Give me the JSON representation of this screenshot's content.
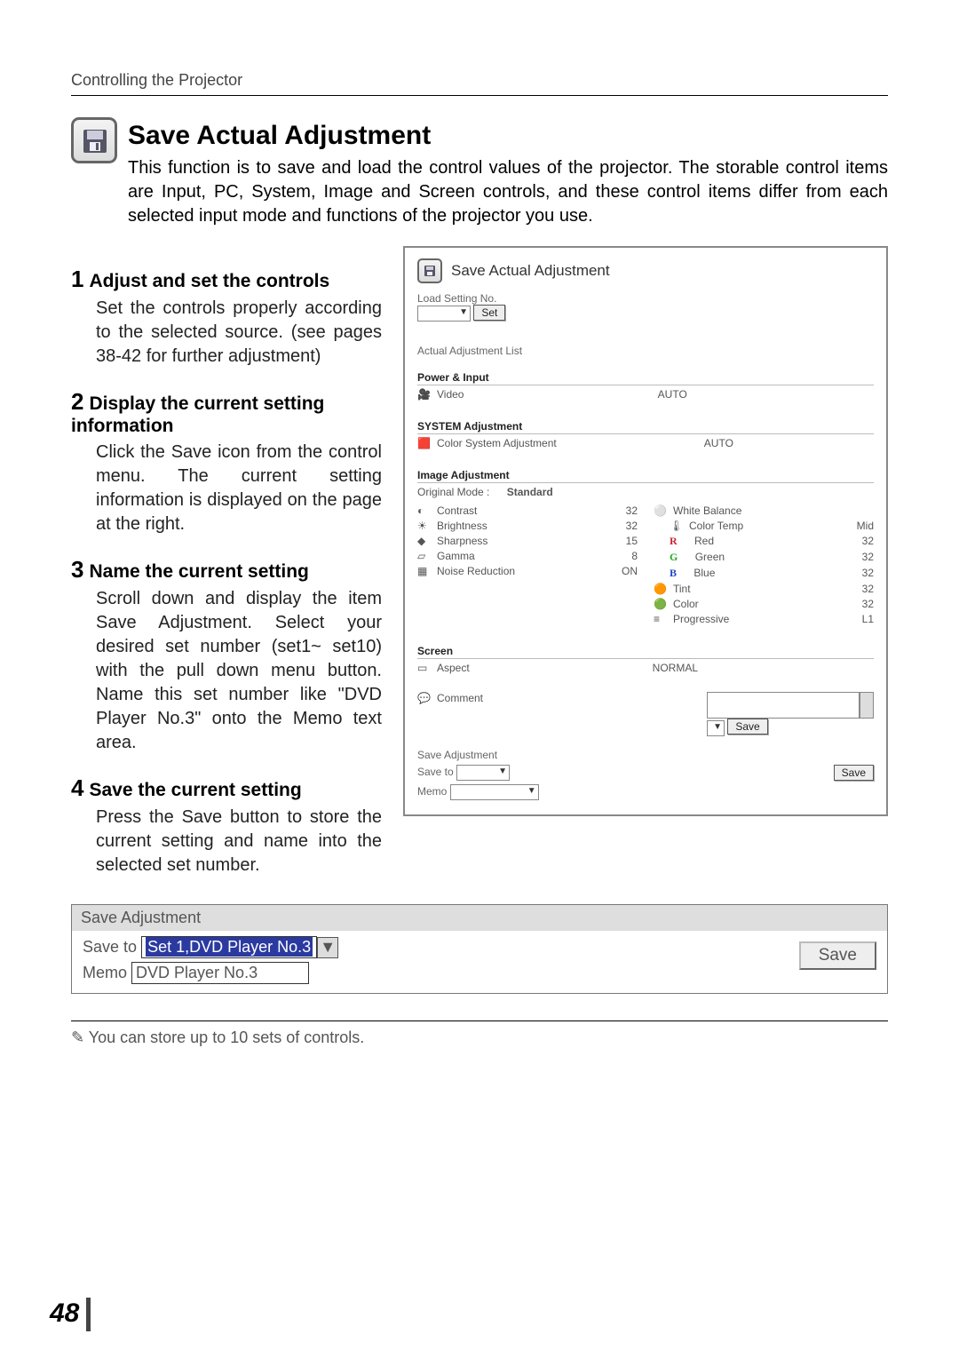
{
  "running_head": "Controlling the Projector",
  "title": "Save Actual Adjustment",
  "intro": "This function is to save and load the control values of the projector. The storable control items are Input, PC, System, Image and Screen controls, and these control items differ from each selected input mode and functions of the projector you use.",
  "steps": [
    {
      "num": "1",
      "head": "Adjust and set the controls",
      "body": "Set the controls properly according to the selected source. (see pages 38-42 for further adjustment)"
    },
    {
      "num": "2",
      "head": "Display the current setting information",
      "body": "Click the Save icon from the control menu. The current setting information is displayed on the page at the right."
    },
    {
      "num": "3",
      "head": "Name the current setting",
      "body": "Scroll down and display the item Save Adjustment. Select your desired set number (set1~ set10) with the pull down menu button. Name this set number like \"DVD Player No.3\" onto the Memo text area."
    },
    {
      "num": "4",
      "head": "Save the current setting",
      "body": "Press the Save button to store the current setting and name into the selected set number."
    }
  ],
  "panel": {
    "title": "Save Actual Adjustment",
    "load_setting_label": "Load Setting No.",
    "set_btn": "Set",
    "list_header": "Actual Adjustment List",
    "power_input": {
      "head": "Power & Input",
      "rows": [
        {
          "name": "Video",
          "value": "AUTO"
        }
      ]
    },
    "system": {
      "head": "SYSTEM Adjustment",
      "rows": [
        {
          "name": "Color System Adjustment",
          "value": "AUTO"
        }
      ]
    },
    "image": {
      "head": "Image Adjustment",
      "mode_label": "Original Mode :",
      "mode_value": "Standard",
      "left": [
        {
          "name": "Contrast",
          "value": "32"
        },
        {
          "name": "Brightness",
          "value": "32"
        },
        {
          "name": "Sharpness",
          "value": "15"
        },
        {
          "name": "Gamma",
          "value": "8"
        },
        {
          "name": "Noise Reduction",
          "value": "ON"
        }
      ],
      "right_head": "White Balance",
      "right": [
        {
          "name": "Color Temp",
          "value": "Mid"
        },
        {
          "name": "Red",
          "value": "32",
          "color": "#c23"
        },
        {
          "name": "Green",
          "value": "32",
          "color": "#2a2"
        },
        {
          "name": "Blue",
          "value": "32",
          "color": "#24c"
        },
        {
          "name": "Tint",
          "value": "32"
        },
        {
          "name": "Color",
          "value": "32"
        },
        {
          "name": "Progressive",
          "value": "L1"
        }
      ]
    },
    "screen": {
      "head": "Screen",
      "rows": [
        {
          "name": "Aspect",
          "value": "NORMAL"
        }
      ]
    },
    "comment": {
      "label": "Comment",
      "save_btn": "Save"
    },
    "save_adj": {
      "head": "Save Adjustment",
      "save_to_label": "Save to",
      "memo_label": "Memo",
      "save_btn": "Save"
    }
  },
  "bottom_panel": {
    "head": "Save Adjustment",
    "save_to_label": "Save to",
    "save_to_value": "Set 1,DVD Player No.3",
    "memo_label": "Memo",
    "memo_value": "DVD Player No.3",
    "save_btn": "Save"
  },
  "footnote": "✎ You can store up to 10 sets of controls.",
  "page_number": "48"
}
